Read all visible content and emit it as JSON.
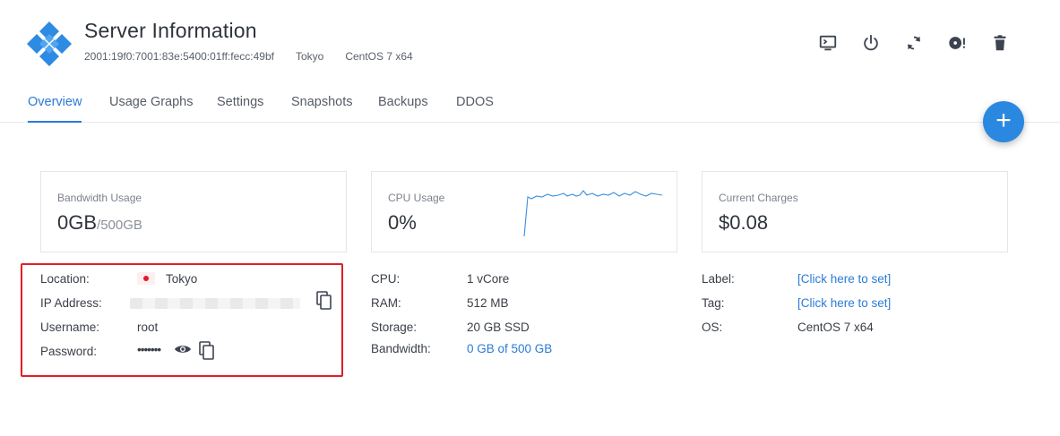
{
  "header": {
    "title": "Server Information",
    "ipv6": "2001:19f0:7001:83e:5400:01ff:fecc:49bf",
    "location": "Tokyo",
    "os": "CentOS 7 x64"
  },
  "actions": [
    {
      "name": "console-icon"
    },
    {
      "name": "power-icon"
    },
    {
      "name": "restart-icon"
    },
    {
      "name": "iso-icon"
    },
    {
      "name": "delete-icon"
    }
  ],
  "tabs": [
    {
      "label": "Overview",
      "active": true
    },
    {
      "label": "Usage Graphs"
    },
    {
      "label": "Settings"
    },
    {
      "label": "Snapshots"
    },
    {
      "label": "Backups"
    },
    {
      "label": "DDOS"
    }
  ],
  "fab": {
    "label": "+"
  },
  "cards": {
    "bandwidth": {
      "label": "Bandwidth Usage",
      "value": "0GB",
      "total": "/500GB"
    },
    "cpu": {
      "label": "CPU Usage",
      "value": "0%"
    },
    "charges": {
      "label": "Current Charges",
      "value": "$0.08"
    }
  },
  "access": {
    "location_label": "Location:",
    "location_value": "Tokyo",
    "ip_label": "IP Address:",
    "username_label": "Username:",
    "username_value": "root",
    "password_label": "Password:",
    "password_value": "•••••••"
  },
  "specs": {
    "cpu_label": "CPU:",
    "cpu_value": "1 vCore",
    "ram_label": "RAM:",
    "ram_value": "512 MB",
    "storage_label": "Storage:",
    "storage_value": "20 GB SSD",
    "bandwidth_label": "Bandwidth:",
    "bandwidth_value": "0 GB of 500 GB"
  },
  "meta": {
    "label_label": "Label:",
    "label_value": "[Click here to set]",
    "tag_label": "Tag:",
    "tag_value": "[Click here to set]",
    "os_label": "OS:",
    "os_value": "CentOS 7 x64"
  },
  "colors": {
    "accent": "#2a7bd6",
    "fab": "#2b88e0",
    "highlight": "#e21d24"
  }
}
